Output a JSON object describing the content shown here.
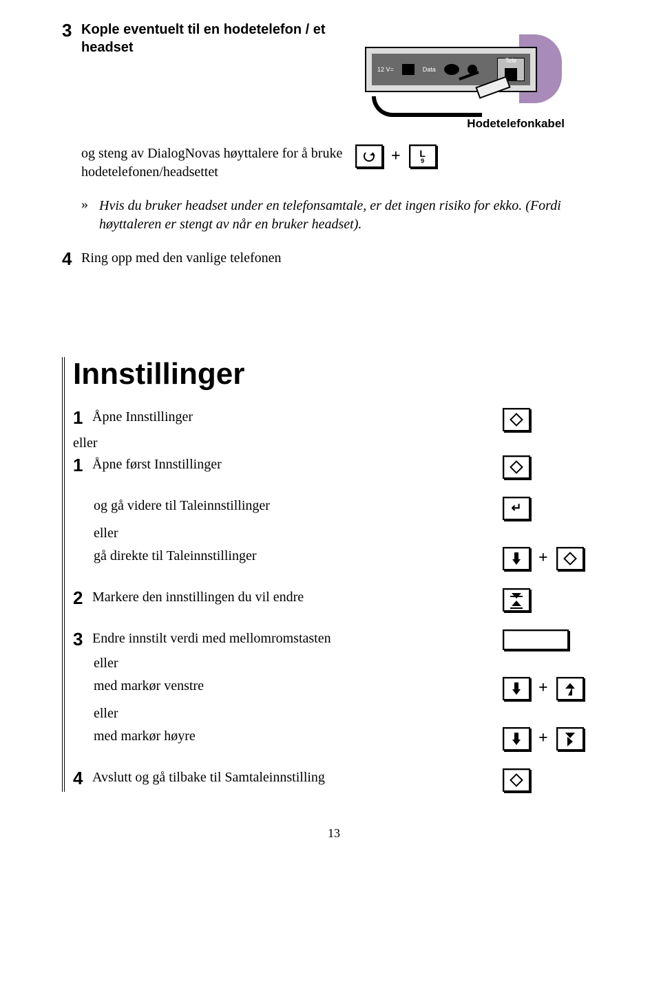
{
  "section1": {
    "step3_title": "Kople eventuelt til en hodetelefon / et headset",
    "illustration": {
      "label_12v": "12 V=",
      "label_data": "Data",
      "label_tele": "Tele",
      "caption": "Hodetelefonkabel"
    },
    "sub_text": "og steng av DialogNovas høyttalere for å bruke hodetelefonen/headsettet",
    "key_refresh": "refresh-icon",
    "key_L": "L",
    "key_L_sub": "9",
    "plus": "+",
    "note_marker": "»",
    "note_text": "Hvis du bruker headset under en telefonsamtale, er det ingen risiko for ekko. (Fordi høyttaleren er stengt av når en bruker headset).",
    "step4_title": "Ring opp med den vanlige telefonen"
  },
  "section2": {
    "heading": "Innstillinger",
    "step1a": {
      "num": "1",
      "label": "Åpne Innstillinger"
    },
    "eller_1": "eller",
    "step1b": {
      "num": "1",
      "label": "Åpne først Innstillinger"
    },
    "sub_a": "og gå videre til Taleinnstillinger",
    "eller_2": "eller",
    "sub_b": "gå direkte til Taleinnstillinger",
    "step2": {
      "num": "2",
      "label": "Markere den innstillingen du vil endre"
    },
    "step3": {
      "num": "3",
      "label": "Endre innstilt verdi med mellomromstasten"
    },
    "eller_3": "eller",
    "sub_c": "med markør venstre",
    "eller_4": "eller",
    "sub_d": "med markør høyre",
    "step4": {
      "num": "4",
      "label": "Avslutt og gå tilbake til Samtaleinnstilling"
    },
    "plus": "+"
  },
  "page_number": "13"
}
